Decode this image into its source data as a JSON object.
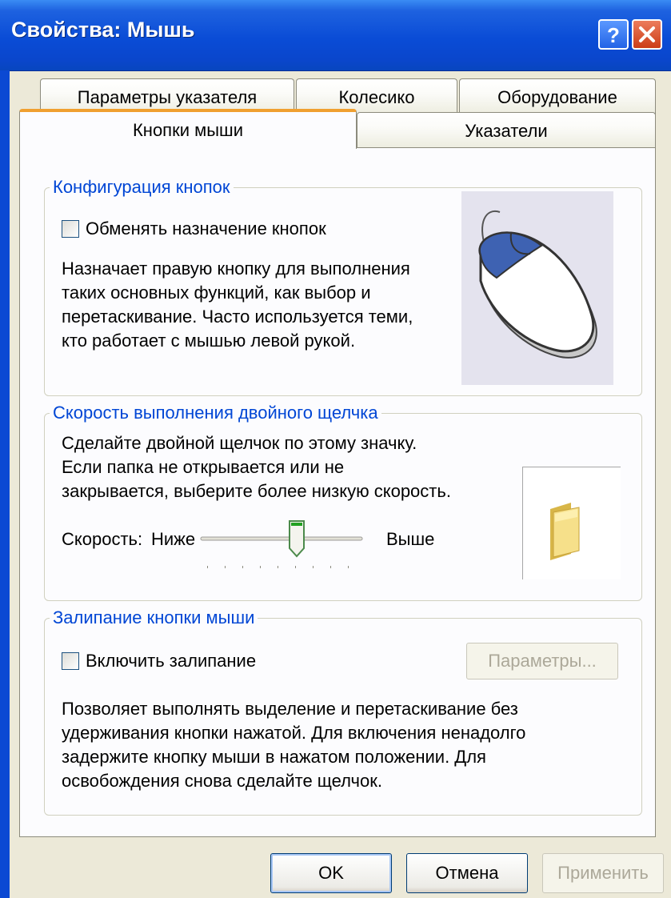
{
  "window": {
    "title": "Свойства: Мышь",
    "help_icon": "help-icon",
    "close_icon": "close-icon"
  },
  "tabs": {
    "row1": [
      "Параметры указателя",
      "Колесико",
      "Оборудование"
    ],
    "row2": [
      "Кнопки мыши",
      "Указатели"
    ],
    "active": "Кнопки мыши"
  },
  "button_config": {
    "legend": "Конфигурация кнопок",
    "checkbox_label": "Обменять назначение кнопок",
    "checked": false,
    "description": [
      "Назначает правую кнопку для выполнения",
      "таких основных функций, как выбор и",
      "перетаскивание. Часто используется теми,",
      "кто работает с мышью левой рукой."
    ],
    "image_icon": "mouse-icon"
  },
  "double_click": {
    "legend": "Скорость выполнения двойного щелчка",
    "description": [
      "Сделайте двойной щелчок по этому значку.",
      "Если папка не открывается или не",
      "закрывается, выберите более низкую скорость."
    ],
    "speed_label": "Скорость:",
    "low_label": "Ниже",
    "high_label": "Выше",
    "slider_value": 0.6,
    "test_icon": "folder-icon"
  },
  "click_lock": {
    "legend": "Залипание кнопки мыши",
    "checkbox_label": "Включить залипание",
    "checked": false,
    "settings_button": "Параметры...",
    "description": [
      "Позволяет выполнять выделение и перетаскивание без",
      "удерживания кнопки нажатой. Для включения ненадолго",
      "задержите кнопку мыши в нажатом положении. Для",
      "освобождения снова сделайте щелчок."
    ]
  },
  "footer": {
    "ok": "OK",
    "cancel": "Отмена",
    "apply": "Применить"
  },
  "colors": {
    "title_bar": "#0a4cd6",
    "dialog_bg": "#ece9d8",
    "group_legend": "#0046d5",
    "active_tab_accent": "#f0a030"
  }
}
